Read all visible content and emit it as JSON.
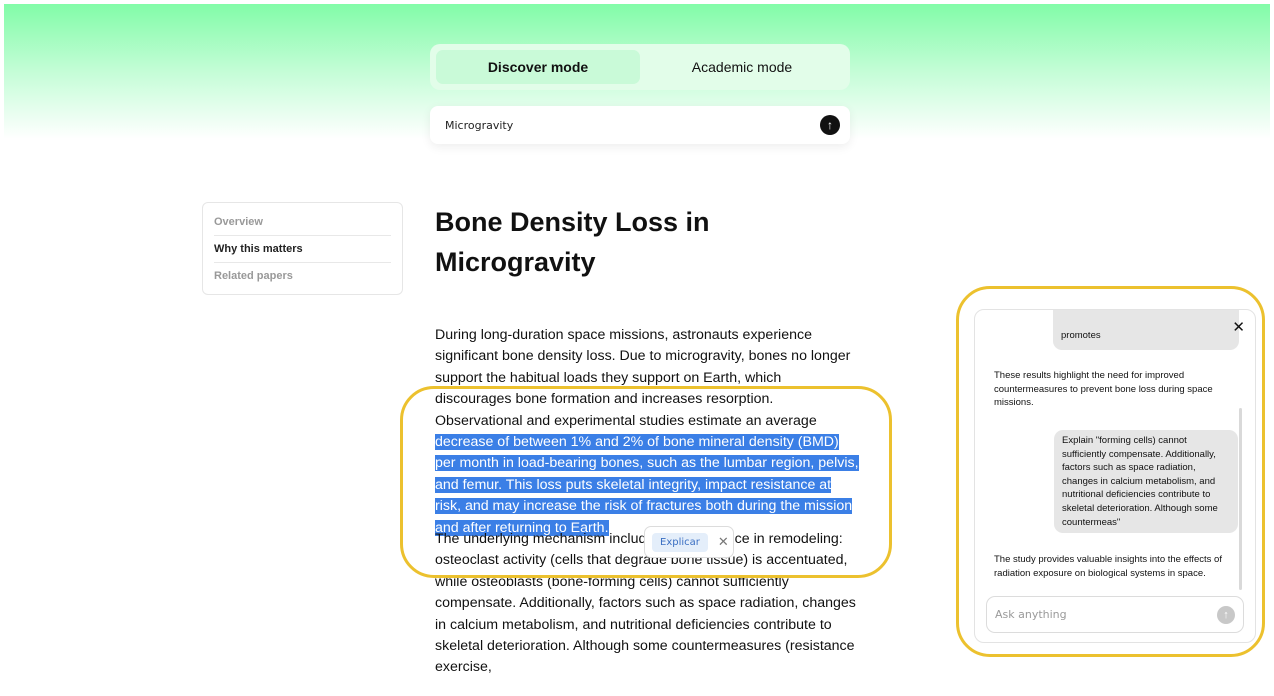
{
  "modes": {
    "discover": "Discover mode",
    "academic": "Academic mode"
  },
  "search": {
    "value": "Microgravity"
  },
  "toc": [
    "Overview",
    "Why this matters",
    "Related papers"
  ],
  "article": {
    "title": "Bone Density Loss in Microgravity",
    "p1_before": "During long-duration space missions, astronauts experience significant bone density loss. Due to microgravity, bones no longer support the habitual loads they support on Earth, which discourages bone formation and increases resorption. Observational and experimental studies estimate an average ",
    "p1_selected": "decrease of between 1% and 2% of bone mineral density (BMD) per month in load-bearing bones, such as the lumbar region, pelvis, and femur. This loss puts skeletal integrity, impact resistance at risk, and may increase the risk of fractures both during the mission and after returning to Earth.",
    "p2": "The underlying mechanism includes an imbalance in remodeling: osteoclast activity (cells that degrade bone tissue) is accentuated, while osteoblasts (bone-forming cells) cannot sufficiently compensate. Additionally, factors such as space radiation, changes in calcium metabolism, and nutritional deficiencies contribute to skeletal deterioration. Although some countermeasures (resistance exercise,"
  },
  "popup": {
    "explain": "Explicar"
  },
  "chat": {
    "partial_user": "promotes",
    "ai_1": "These results highlight the need for improved countermeasures to prevent bone loss during space missions.",
    "user_1": "Explain \"forming cells) cannot sufficiently compensate. Additionally, factors such as space radiation, changes in calcium metabolism, and nutritional deficiencies contribute to skeletal deterioration. Although some countermeas\"",
    "ai_2": "The study provides valuable insights into the effects of radiation exposure on biological systems in space.",
    "input_placeholder": "Ask anything"
  },
  "colors": {
    "accent_green": "#82fca8",
    "highlight": "#3b7fe6",
    "outline": "#ecc12e"
  },
  "icons": {
    "send": "arrow-up-icon",
    "close": "close-icon"
  }
}
